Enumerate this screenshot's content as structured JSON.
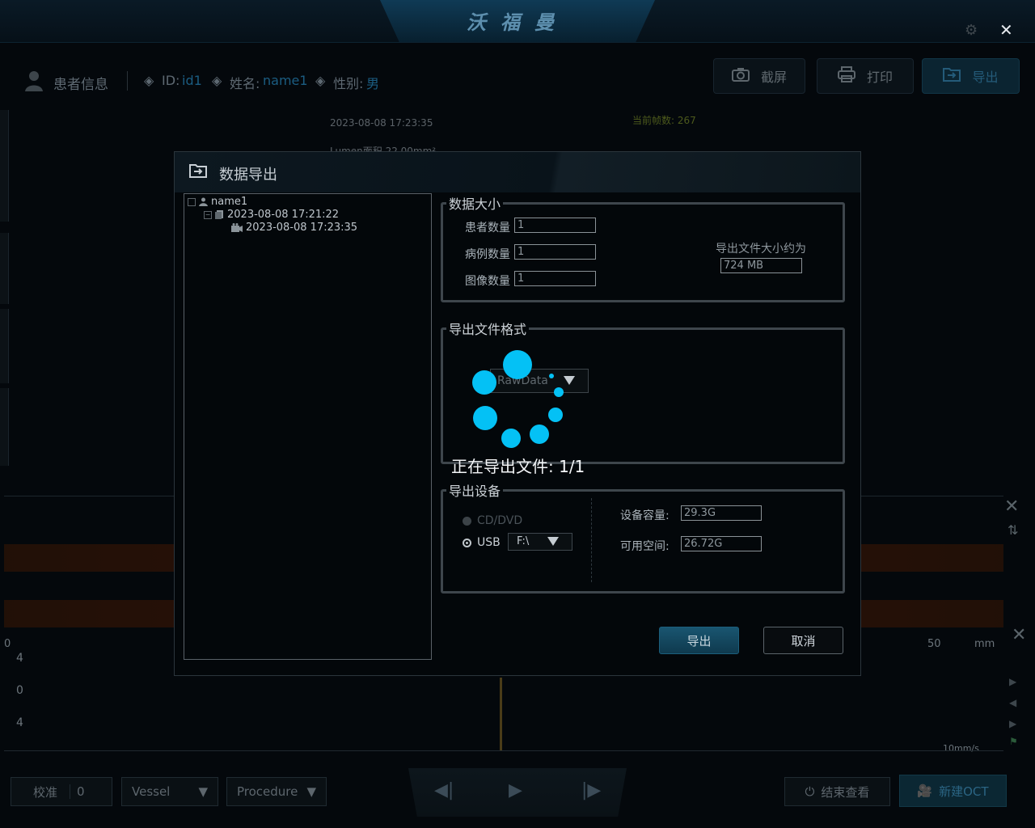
{
  "app": {
    "brand": "沃福曼",
    "settings_icon": "gear-icon",
    "close_icon": "close-icon"
  },
  "patient_bar": {
    "title": "患者信息",
    "id_label": "ID:",
    "id_value": "id1",
    "name_label": "姓名:",
    "name_value": "name1",
    "gender_label": "性别:",
    "gender_value": "男"
  },
  "toolbar": {
    "screenshot": "截屏",
    "print": "打印",
    "export": "导出"
  },
  "viewer": {
    "timestamp": "2023-08-08 17:23:35",
    "frame_count": "当前帧数: 267",
    "lumen_text": "Lumen面积 22.00mm²"
  },
  "lview": {
    "tick_0": "0",
    "tick_50": "50",
    "unit": "mm",
    "y_labels": [
      "4",
      "0",
      "4"
    ],
    "speed": "10mm/s"
  },
  "bottom": {
    "calibrate": "校准",
    "calibrate_value": "0",
    "vessel": "Vessel",
    "procedure": "Procedure",
    "end_view": "结束查看",
    "new_oct": "新建OCT"
  },
  "dialog": {
    "title": "数据导出",
    "tree": {
      "patient": "name1",
      "case": "2023-08-08 17:21:22",
      "image": "2023-08-08 17:23:35"
    },
    "size_group": {
      "legend": "数据大小",
      "patient_count_label": "患者数量",
      "patient_count": "1",
      "case_count_label": "病例数量",
      "case_count": "1",
      "image_count_label": "图像数量",
      "image_count": "1",
      "approx_label": "导出文件大小约为",
      "approx_value": "724 MB"
    },
    "format_group": {
      "legend": "导出文件格式",
      "selected": "RawData"
    },
    "device_group": {
      "legend": "导出设备",
      "option_cd": "CD/DVD",
      "option_usb": "USB",
      "usb_drive": "F:\\",
      "capacity_label": "设备容量:",
      "capacity_value": "29.3G",
      "free_label": "可用空间:",
      "free_value": "26.72G"
    },
    "export_button": "导出",
    "cancel_button": "取消"
  },
  "loading": {
    "progress_text": "正在导出文件: 1/1",
    "accent_color": "#04c1f5"
  }
}
